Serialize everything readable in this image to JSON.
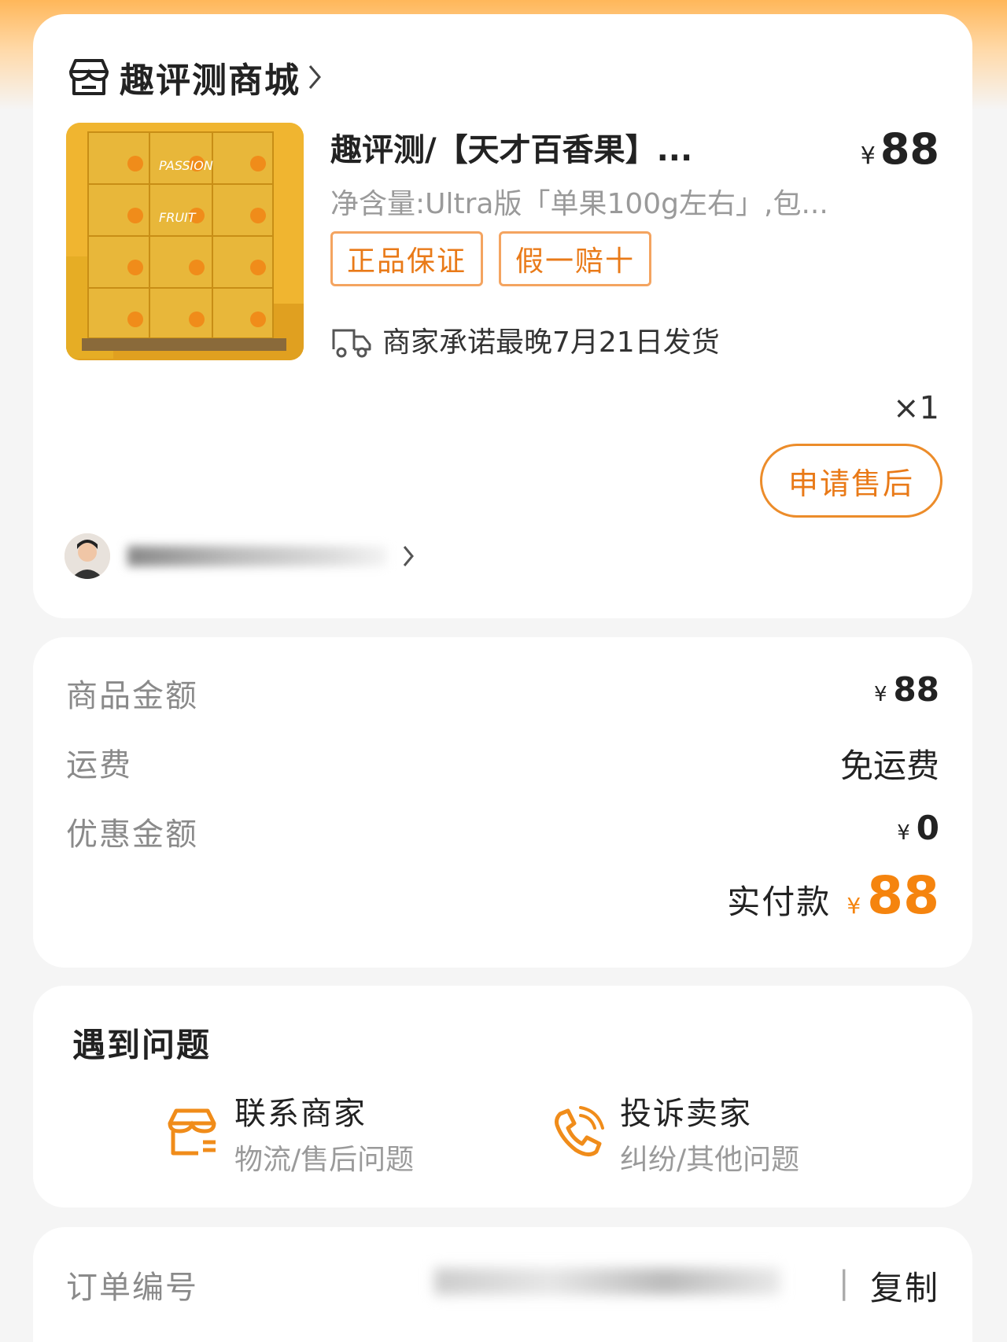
{
  "shop": {
    "name": "趣评测商城"
  },
  "product": {
    "title": "趣评测/【天才百香果】...",
    "price_symbol": "¥",
    "price": "88",
    "spec": "净含量:Ultra版「单果100g左右」,包...",
    "tags": [
      "正品保证",
      "假一赔十"
    ],
    "shipping_note": "商家承诺最晚7月21日发货",
    "quantity": "×1",
    "after_sale_label": "申请售后",
    "image_texts": [
      "PASSION",
      "FRUIT"
    ]
  },
  "price_breakdown": {
    "goods_amount_label": "商品金额",
    "goods_amount_symbol": "¥",
    "goods_amount": "88",
    "shipping_label": "运费",
    "shipping_value": "免运费",
    "discount_label": "优惠金额",
    "discount_symbol": "¥",
    "discount_value": "0",
    "paid_label": "实付款",
    "paid_symbol": "¥",
    "paid_value": "88"
  },
  "help": {
    "title": "遇到问题",
    "items": [
      {
        "label": "联系商家",
        "sub": "物流/售后问题",
        "icon": "store-icon"
      },
      {
        "label": "投诉卖家",
        "sub": "纠纷/其他问题",
        "icon": "phone-icon"
      }
    ]
  },
  "order_info": {
    "order_no_label": "订单编号",
    "separator": "|",
    "copy_label": "复制"
  },
  "colors": {
    "accent": "#f5840e",
    "tag_border": "#f4a460",
    "card_bg": "#ffffff",
    "page_bg": "#f5f5f5"
  }
}
